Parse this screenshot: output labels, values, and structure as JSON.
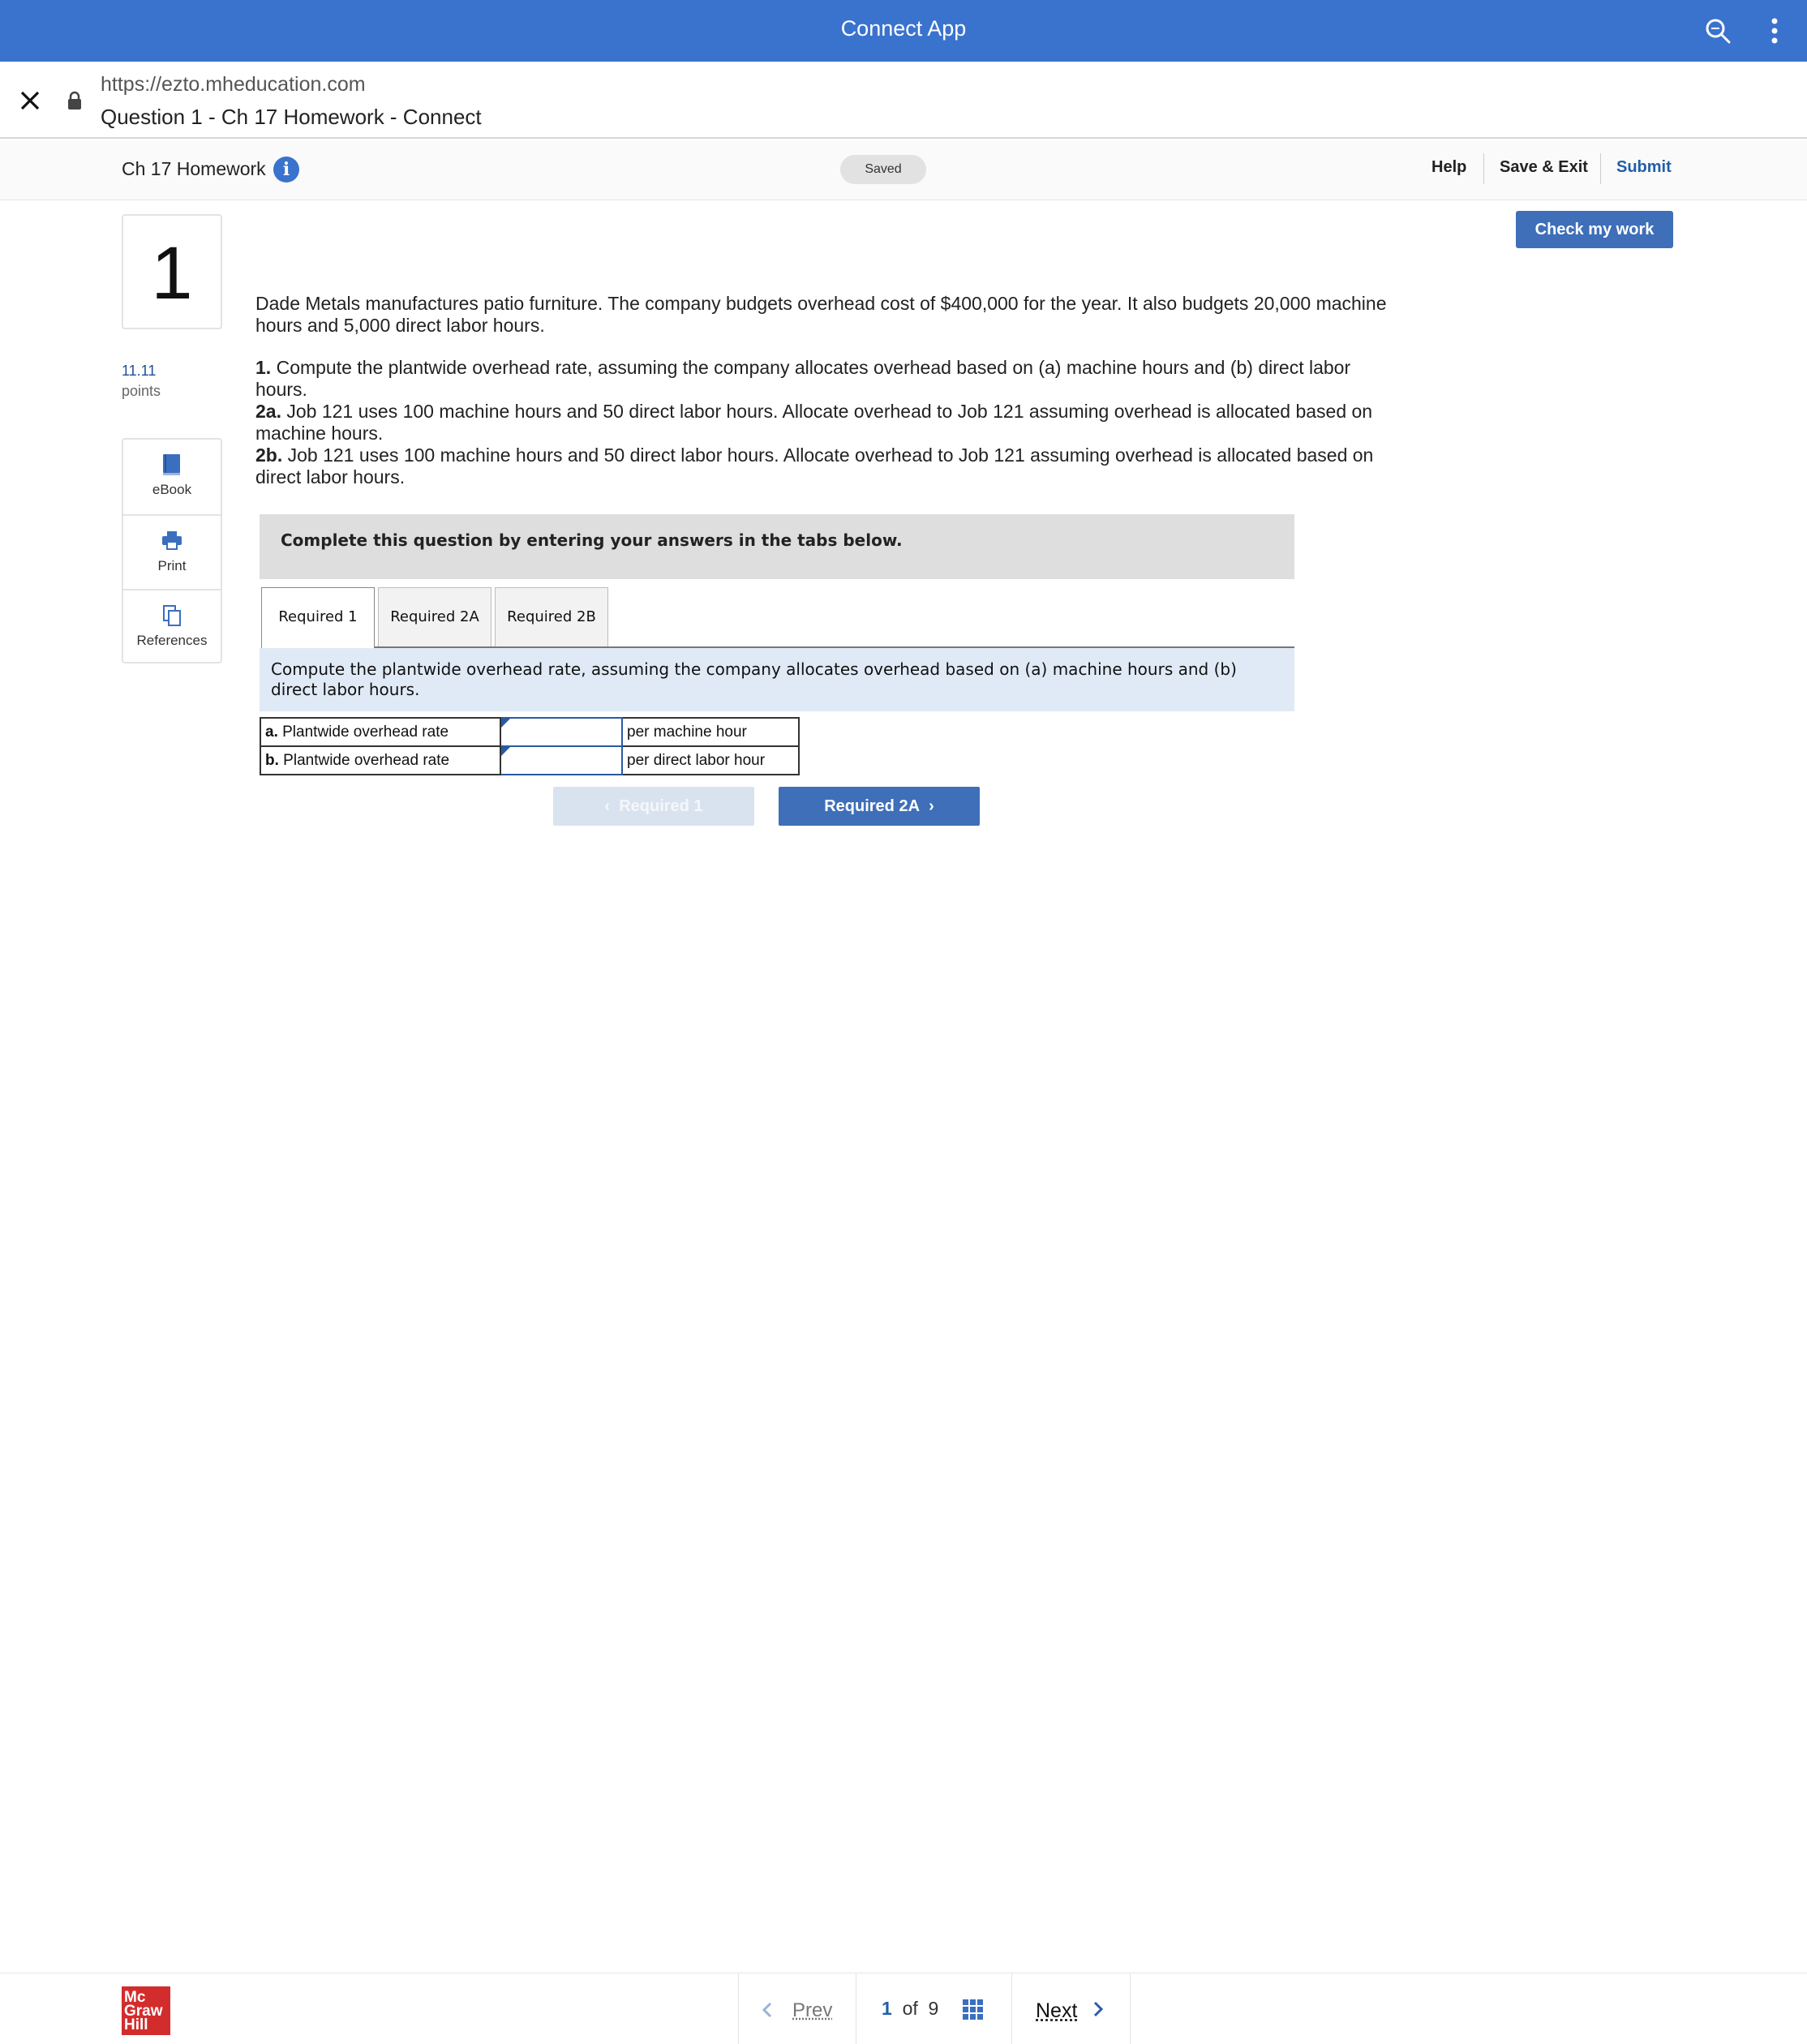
{
  "app_bar": {
    "title": "Connect App"
  },
  "browser": {
    "url": "https://ezto.mheducation.com",
    "page_title": "Question 1 - Ch 17 Homework - Connect"
  },
  "assignment": {
    "name": "Ch 17 Homework",
    "info_icon": "i",
    "status": "Saved",
    "help": "Help",
    "save_exit": "Save & Exit",
    "submit": "Submit",
    "check_my_work": "Check my work"
  },
  "question": {
    "number": "1",
    "points_value": "11.11",
    "points_label": "points",
    "intro": "Dade Metals manufactures patio furniture. The company budgets overhead cost of $400,000 for the year. It also budgets 20,000 machine hours and 5,000 direct labor hours.",
    "req1_label": "1.",
    "req1_text": " Compute the plantwide overhead rate, assuming the company allocates overhead based on (a) machine hours and (b) direct labor hours.",
    "req2a_label": "2a.",
    "req2a_text": " Job 121 uses 100 machine hours and 50 direct labor hours. Allocate overhead to Job 121 assuming overhead is allocated based on machine hours.",
    "req2b_label": "2b.",
    "req2b_text": " Job 121 uses 100 machine hours and 50 direct labor hours. Allocate overhead to Job 121 assuming overhead is allocated based on direct labor hours."
  },
  "tools": [
    {
      "label": "eBook",
      "icon": "book-icon"
    },
    {
      "label": "Print",
      "icon": "printer-icon"
    },
    {
      "label": "References",
      "icon": "copy-icon"
    }
  ],
  "instructions": "Complete this question by entering your answers in the tabs below.",
  "tabs": [
    "Required 1",
    "Required 2A",
    "Required 2B"
  ],
  "active_tab": "Required 1",
  "tab_instruction": "Compute the plantwide overhead rate, assuming the company allocates overhead based on (a) machine hours and (b) direct labor hours.",
  "answer_rows": [
    {
      "prefix": "a.",
      "label": " Plantwide overhead rate",
      "value": "",
      "unit": "per machine hour"
    },
    {
      "prefix": "b.",
      "label": " Plantwide overhead rate",
      "value": "",
      "unit": "per direct labor hour"
    }
  ],
  "tab_nav": {
    "prev": "Required 1",
    "next": "Required 2A"
  },
  "footer": {
    "logo_lines": [
      "Mc",
      "Graw",
      "Hill"
    ],
    "prev": "Prev",
    "page_current": "1",
    "page_of": "of",
    "page_total": "9",
    "next": "Next"
  },
  "colors": {
    "brand_blue": "#3a73cd",
    "button_blue": "#3e6fb8",
    "logo_red": "#d32c2c"
  }
}
